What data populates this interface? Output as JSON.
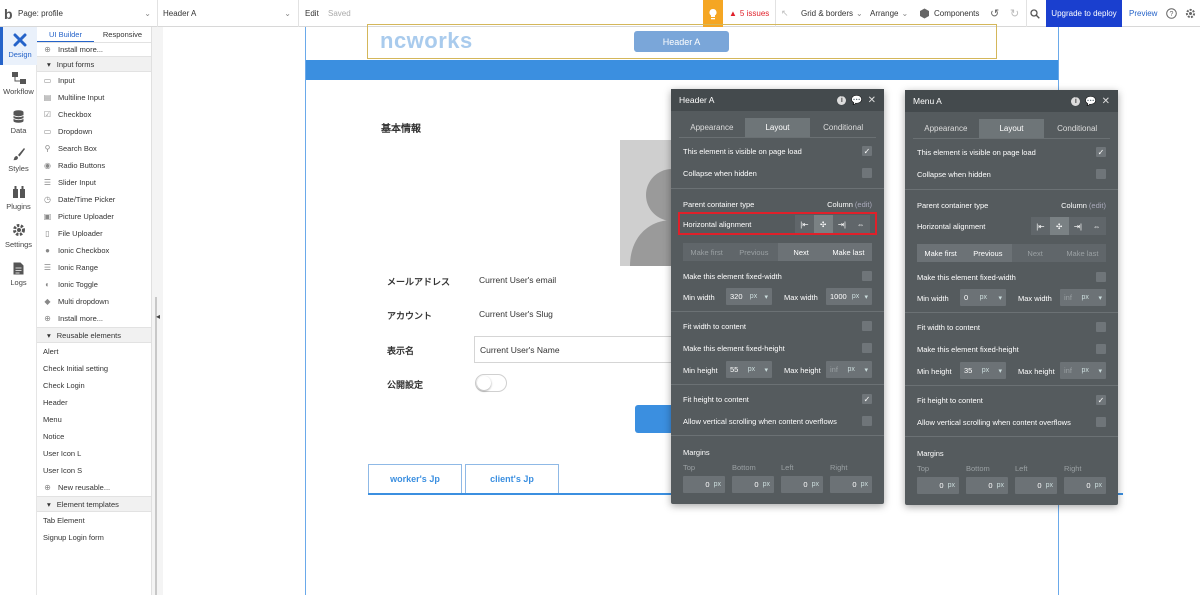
{
  "topbar": {
    "logo": "b",
    "page_label": "Page: profile",
    "element_select": "Header A",
    "edit": "Edit",
    "saved": "Saved",
    "issues": "5 issues",
    "grid": "Grid & borders",
    "arrange": "Arrange",
    "components": "Components",
    "upgrade": "Upgrade to deploy",
    "preview": "Preview"
  },
  "nav": {
    "items": [
      {
        "label": "Design",
        "icon": "design-icon"
      },
      {
        "label": "Workflow",
        "icon": "workflow-icon"
      },
      {
        "label": "Data",
        "icon": "data-icon"
      },
      {
        "label": "Styles",
        "icon": "styles-icon"
      },
      {
        "label": "Plugins",
        "icon": "plugins-icon"
      },
      {
        "label": "Settings",
        "icon": "settings-icon"
      },
      {
        "label": "Logs",
        "icon": "logs-icon"
      }
    ]
  },
  "palette": {
    "tabs": [
      "UI Builder",
      "Responsive"
    ],
    "install_top": "Install more...",
    "input_section": "Input forms",
    "inputs": [
      "Input",
      "Multiline Input",
      "Checkbox",
      "Dropdown",
      "Search Box",
      "Radio Buttons",
      "Slider Input",
      "Date/Time Picker",
      "Picture Uploader",
      "File Uploader",
      "Ionic Checkbox",
      "Ionic Range",
      "Ionic Toggle",
      "Multi dropdown"
    ],
    "install_more": "Install more...",
    "reusable_section": "Reusable elements",
    "reusables": [
      "Alert",
      "Check Initial setting",
      "Check Login",
      "Header",
      "Menu",
      "Notice",
      "User Icon L",
      "User Icon S"
    ],
    "new_reusable": "New reusable...",
    "templates_section": "Element templates",
    "templates": [
      "Tab Element",
      "Signup Login form"
    ]
  },
  "canvas": {
    "logo_text": "ncworks",
    "header_button": "Header A",
    "section_title": "基本情報",
    "fields": [
      {
        "label": "メールアドレス",
        "value": "Current User's email"
      },
      {
        "label": "アカウント",
        "value": "Current User's Slug"
      },
      {
        "label": "表示名",
        "value": "Current User's Name"
      },
      {
        "label": "公開設定",
        "value": ""
      }
    ],
    "tabs": [
      "worker's Jp",
      "client's Jp"
    ]
  },
  "panel_header": {
    "title": "Header A",
    "tabs": [
      "Appearance",
      "Layout",
      "Conditional"
    ],
    "visible_label": "This element is visible on page load",
    "visible_checked": true,
    "collapse_label": "Collapse when hidden",
    "parent_type_label": "Parent container type",
    "parent_type_value": "Column",
    "edit": "(edit)",
    "halign_label": "Horizontal alignment",
    "order_buttons": [
      "Make first",
      "Previous",
      "Next",
      "Make last"
    ],
    "fixed_width_label": "Make this element fixed-width",
    "min_width_label": "Min width",
    "min_width": "320",
    "max_width_label": "Max width",
    "max_width": "1000",
    "unit": "px",
    "fit_width_label": "Fit width to content",
    "fixed_height_label": "Make this element fixed-height",
    "min_height_label": "Min height",
    "min_height": "55",
    "max_height_label": "Max height",
    "max_height": "inf",
    "fit_height_label": "Fit height to content",
    "fit_height_checked": true,
    "scroll_label": "Allow vertical scrolling when content overflows",
    "margins_label": "Margins",
    "margin_labels": [
      "Top",
      "Bottom",
      "Left",
      "Right"
    ],
    "margin_values": [
      "0",
      "0",
      "0",
      "0"
    ]
  },
  "panel_menu": {
    "title": "Menu A",
    "tabs": [
      "Appearance",
      "Layout",
      "Conditional"
    ],
    "visible_label": "This element is visible on page load",
    "collapse_label": "Collapse when hidden",
    "parent_type_label": "Parent container type",
    "parent_type_value": "Column",
    "edit": "(edit)",
    "halign_label": "Horizontal alignment",
    "order_buttons": [
      "Make first",
      "Previous",
      "Next",
      "Make last"
    ],
    "fixed_width_label": "Make this element fixed-width",
    "min_width_label": "Min width",
    "min_width": "0",
    "max_width_label": "Max width",
    "max_width": "inf",
    "unit": "px",
    "fit_width_label": "Fit width to content",
    "fixed_height_label": "Make this element fixed-height",
    "min_height_label": "Min height",
    "min_height": "35",
    "max_height_label": "Max height",
    "max_height": "inf",
    "fit_height_label": "Fit height to content",
    "scroll_label": "Allow vertical scrolling when content overflows",
    "margins_label": "Margins",
    "margin_labels": [
      "Top",
      "Bottom",
      "Left",
      "Right"
    ],
    "margin_values": [
      "0",
      "0",
      "0",
      "0"
    ]
  },
  "colors": {
    "accent": "#2563c9",
    "page_blue": "#3b8fe0",
    "panel_bg": "#555b5e",
    "highlight_red": "#e0202a",
    "warning": "#f5a623"
  }
}
